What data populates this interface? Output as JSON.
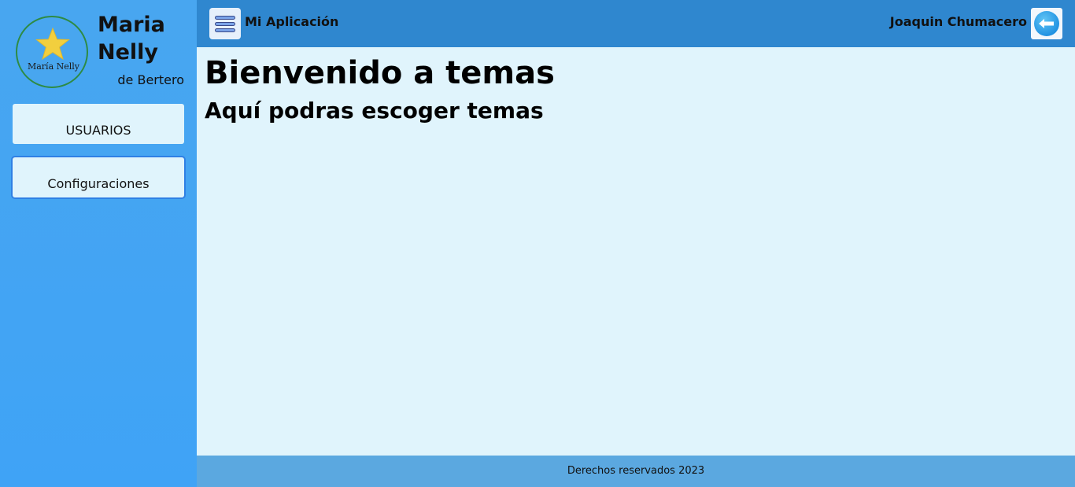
{
  "sidebar": {
    "logo_text": "María Nelly",
    "brand_title": "Maria Nelly",
    "brand_subtitle": "de Bertero",
    "items": [
      {
        "label": "USUARIOS"
      },
      {
        "label": "Configuraciones"
      }
    ]
  },
  "topbar": {
    "app_title": "Mi Aplicación",
    "user_name": "Joaquin Chumacero"
  },
  "main": {
    "heading": "Bienvenido a temas",
    "subheading": "Aquí podras escoger temas"
  },
  "footer": {
    "text": "Derechos reservados 2023"
  },
  "icons": {
    "logo": "star-icon",
    "menu": "hamburger-menu-icon",
    "logout": "arrow-left-circle-icon"
  },
  "colors": {
    "sidebar_bg": "#48a6f0",
    "topbar_bg": "#2f87cf",
    "content_bg": "#e0f4fc",
    "footer_bg": "#5ba8e0",
    "logo_star": "#f2cf3e",
    "logo_ring": "#2e8b44"
  }
}
